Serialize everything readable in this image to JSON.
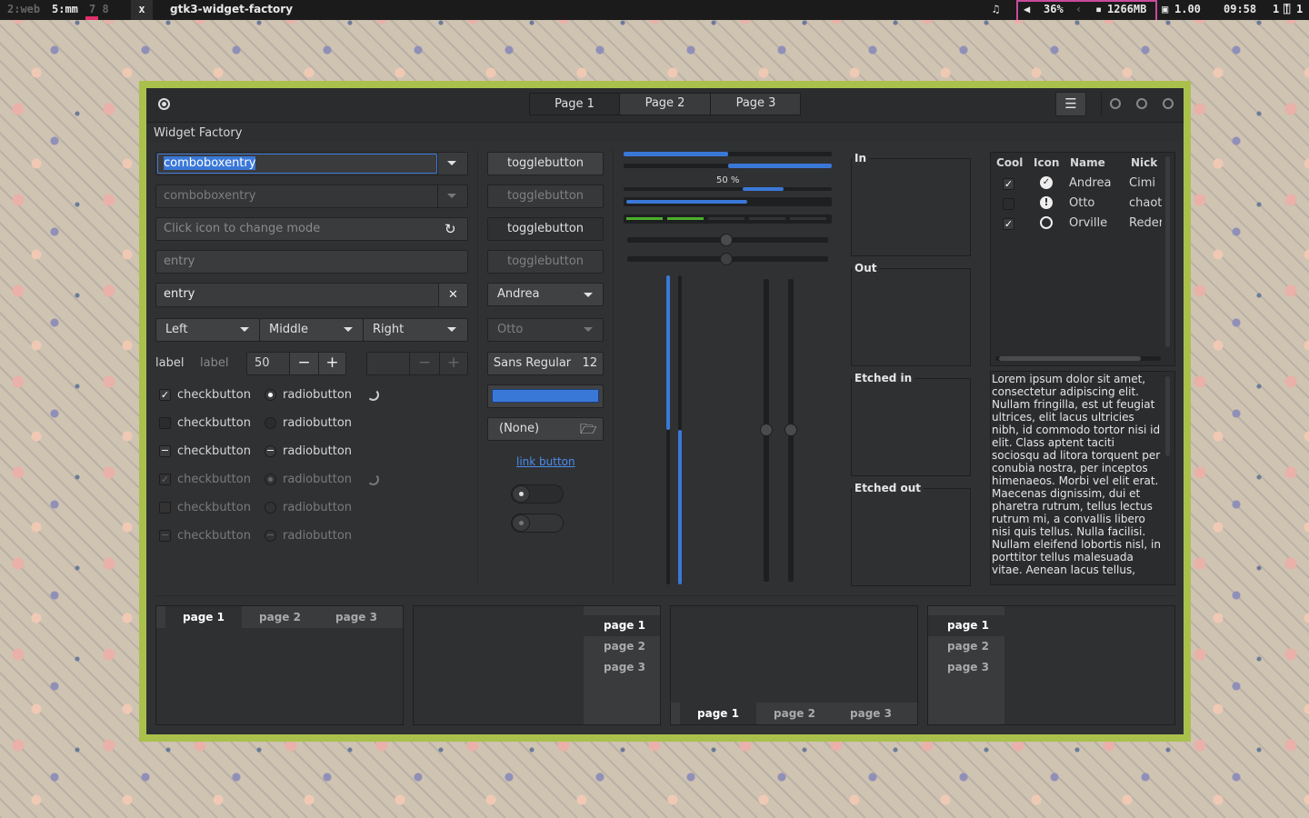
{
  "topbar": {
    "ws_dim": "2:web",
    "ws_active": "5:mm",
    "ws_more": "7 8",
    "close": "x",
    "title": "gtk3-widget-factory",
    "music": "♫",
    "volume": "36%",
    "mem": "1266MB",
    "load": "1.00",
    "clock": "09:58",
    "tray": "1"
  },
  "window": {
    "title": "Widget Factory",
    "tabs": [
      "Page 1",
      "Page 2",
      "Page 3"
    ],
    "menu_icon": "hamburger-icon"
  },
  "col1": {
    "combo1": "comboboxentry",
    "combo2": "comboboxentry",
    "mode_placeholder": "Click icon to change mode",
    "entry_placeholder": "entry",
    "entry_value": "entry",
    "segments": [
      "Left",
      "Middle",
      "Right"
    ],
    "label1": "label",
    "label2": "label",
    "spin_value": "50",
    "checks": [
      "checkbutton",
      "checkbutton",
      "checkbutton",
      "checkbutton",
      "checkbutton",
      "checkbutton"
    ],
    "radios": [
      "radiobutton",
      "radiobutton",
      "radiobutton",
      "radiobutton",
      "radiobutton",
      "radiobutton"
    ]
  },
  "col2": {
    "toggles": [
      "togglebutton",
      "togglebutton",
      "togglebutton",
      "togglebutton"
    ],
    "combo_andrea": "Andrea",
    "combo_otto": "Otto",
    "font_name": "Sans Regular",
    "font_size": "12",
    "file_none": "(None)",
    "link": "link button",
    "accent": "#3a78d8"
  },
  "col3": {
    "progress_label": "50 %"
  },
  "frames": [
    "In",
    "Out",
    "Etched in",
    "Etched out"
  ],
  "tree": {
    "headers": [
      "Cool",
      "Icon",
      "Name",
      "Nick"
    ],
    "rows": [
      {
        "cool": true,
        "name": "Andrea",
        "nick": "Cimi"
      },
      {
        "cool": false,
        "name": "Otto",
        "nick": "chaoti"
      },
      {
        "cool": true,
        "name": "Orville",
        "nick": "Reder"
      }
    ]
  },
  "lorem": "Lorem ipsum dolor sit amet, consectetur adipiscing elit. Nullam fringilla, est ut feugiat ultrices, elit lacus ultricies nibh, id commodo tortor nisi id elit. Class aptent taciti sociosqu ad litora torquent per conubia nostra, per inceptos himenaeos. Morbi vel elit erat. Maecenas dignissim, dui et pharetra rutrum, tellus lectus rutrum mi, a convallis libero nisi quis tellus. Nulla facilisi. Nullam eleifend lobortis nisl, in porttitor tellus malesuada vitae. Aenean lacus tellus,",
  "notebooks": {
    "pages": [
      "page 1",
      "page 2",
      "page 3"
    ]
  }
}
